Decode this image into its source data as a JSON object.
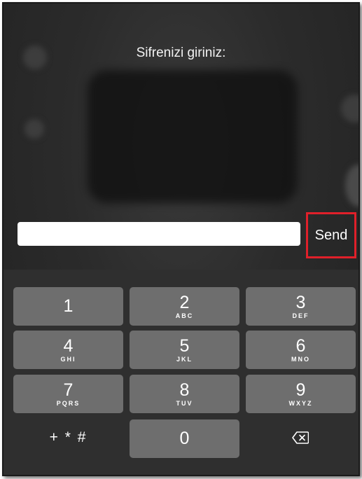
{
  "prompt": "Sifrenizi giriniz:",
  "password_field": {
    "value": "",
    "placeholder": ""
  },
  "send_label": "Send",
  "keys": [
    {
      "num": "1",
      "letters": ""
    },
    {
      "num": "2",
      "letters": "ABC"
    },
    {
      "num": "3",
      "letters": "DEF"
    },
    {
      "num": "4",
      "letters": "GHI"
    },
    {
      "num": "5",
      "letters": "JKL"
    },
    {
      "num": "6",
      "letters": "MNO"
    },
    {
      "num": "7",
      "letters": "PQRS"
    },
    {
      "num": "8",
      "letters": "TUV"
    },
    {
      "num": "9",
      "letters": "WXYZ"
    },
    {
      "num": "0",
      "letters": ""
    }
  ],
  "symbols_label": "+ * #",
  "delete_icon": "backspace-icon",
  "colors": {
    "highlight": "#e0202a",
    "key_bg": "#6e6e6e",
    "keypad_bg": "#2f2f2f"
  }
}
